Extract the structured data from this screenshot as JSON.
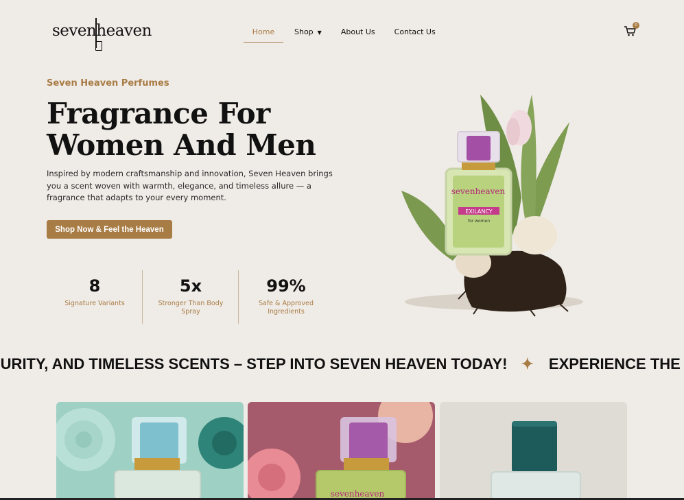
{
  "brand": {
    "logo_text": "sevenheaven"
  },
  "nav": {
    "items": [
      {
        "label": "Home",
        "active": true
      },
      {
        "label": "Shop",
        "has_dropdown": true
      },
      {
        "label": "About Us"
      },
      {
        "label": "Contact Us"
      }
    ]
  },
  "cart": {
    "count": "0",
    "icon": "cart-icon"
  },
  "hero": {
    "kicker": "Seven Heaven Perfumes",
    "title": "Fragrance For Women And Men",
    "description": "Inspired by modern craftsmanship and innovation, Seven Heaven brings you a scent woven with warmth, elegance, and timeless allure — a fragrance that adapts to your every moment.",
    "cta_label": "Shop Now & Feel the Heaven",
    "product_label": {
      "brand": "sevenheaven",
      "name": "EXILANCY",
      "sub": "for women"
    }
  },
  "stats": [
    {
      "value": "8",
      "label": "Signature Variants"
    },
    {
      "value": "5x",
      "label": "Stronger Than Body Spray"
    },
    {
      "value": "99%",
      "label": "Safe & Approved Ingredients"
    }
  ],
  "marquee": {
    "text_1": "PURITY, AND TIMELESS SCENTS – STEP INTO SEVEN HEAVEN TODAY!",
    "text_2": "EXPERIENCE THE EL",
    "separator_icon": "sparkle-icon"
  },
  "products": [
    {
      "image": "teal-roses-perfume"
    },
    {
      "image": "pink-roses-perfume",
      "label_text": "sevenheaven"
    },
    {
      "image": "green-cap-perfume"
    }
  ],
  "colors": {
    "accent": "#a87c45",
    "background": "#efebe6",
    "text": "#111111"
  }
}
